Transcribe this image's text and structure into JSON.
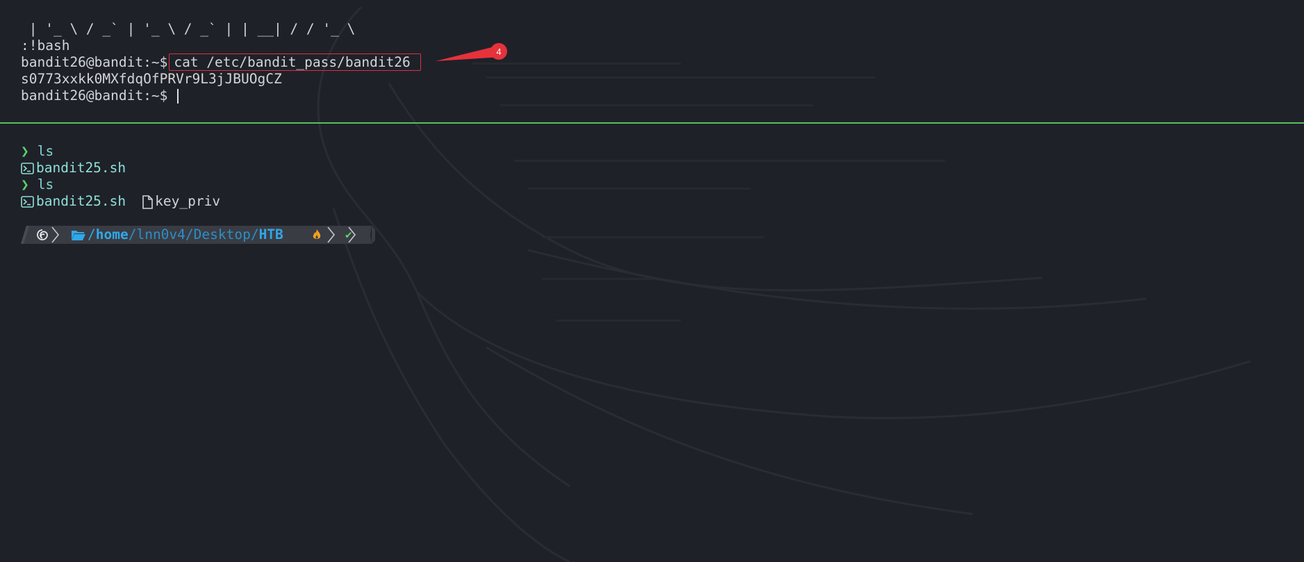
{
  "top_pane": {
    "ascii_art": " | '_ \\ / _` | '_ \\ / _` | | __| / / '_ \\",
    "bash_line": ":!bash",
    "prompt": "bandit26@bandit:~$",
    "command": "cat /etc/bandit_pass/bandit26",
    "output": "s0773xxkk0MXfdqOfPRVr9L3jJBUOgCZ",
    "annotation_number": "4"
  },
  "bottom_pane": {
    "entries": [
      {
        "command": "ls",
        "files": [
          "bandit25.sh"
        ]
      },
      {
        "command": "ls",
        "files": [
          "bandit25.sh",
          "key_priv"
        ]
      }
    ],
    "powerline": {
      "os_icon": "debian-swirl-icon",
      "path_prefix": "/",
      "path_home": "home",
      "path_mid": "/lnn0v4/Desktop/",
      "path_last": "HTB",
      "status_icon": "fire-icon",
      "check": "✔"
    }
  },
  "colors": {
    "background": "#1f2129",
    "divider": "#57c25b",
    "annotation": "#e5323b",
    "path": "#2fa8e8",
    "prompt_arrow": "#5cd16a"
  }
}
